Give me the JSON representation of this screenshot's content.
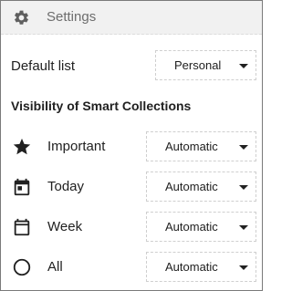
{
  "header": {
    "title": "Settings",
    "icon": "gear-icon"
  },
  "default_list": {
    "label": "Default list",
    "selected": "Personal"
  },
  "visibility": {
    "title": "Visibility of Smart Collections",
    "items": [
      {
        "label": "Important",
        "icon": "star-icon",
        "selected": "Automatic"
      },
      {
        "label": "Today",
        "icon": "calendar-today-icon",
        "selected": "Automatic"
      },
      {
        "label": "Week",
        "icon": "calendar-week-icon",
        "selected": "Automatic"
      },
      {
        "label": "All",
        "icon": "circle-outline-icon",
        "selected": "Automatic"
      }
    ]
  }
}
